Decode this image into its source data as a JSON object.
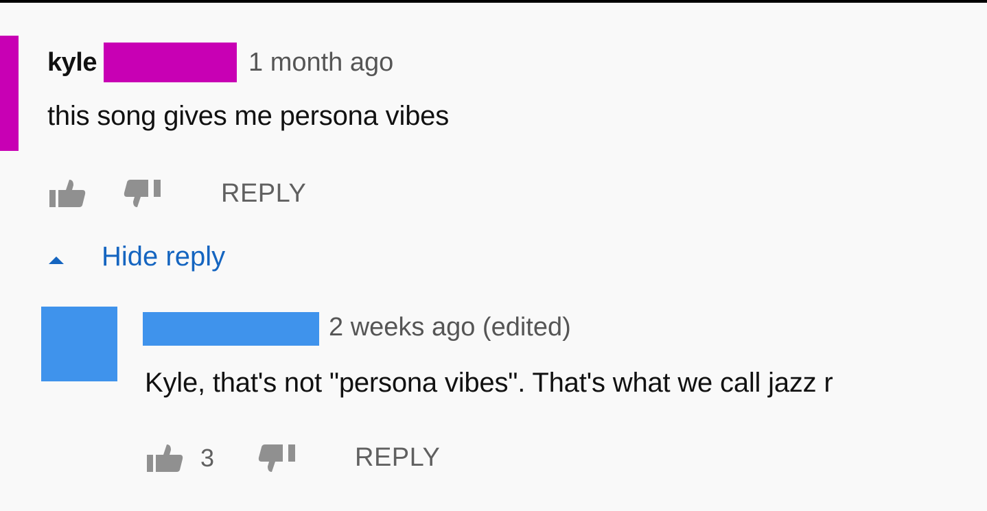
{
  "comment": {
    "author": "kyle",
    "timestamp": "1 month ago",
    "text": "this song gives me persona vibes",
    "reply_label": "REPLY",
    "avatar_color": "#c800b4"
  },
  "thread_toggle": {
    "label": "Hide reply",
    "icon": "caret-up-icon",
    "color": "#1565c0"
  },
  "reply": {
    "timestamp": "2 weeks ago (edited)",
    "text": "Kyle, that's not \"persona vibes\". That's what we call jazz r",
    "like_count": "3",
    "reply_label": "REPLY",
    "avatar_color": "#3f93ec"
  },
  "icons": {
    "like": "thumbs-up-icon",
    "dislike": "thumbs-down-icon"
  },
  "colors": {
    "background": "#f9f9f9",
    "icon_gray": "#909090"
  }
}
